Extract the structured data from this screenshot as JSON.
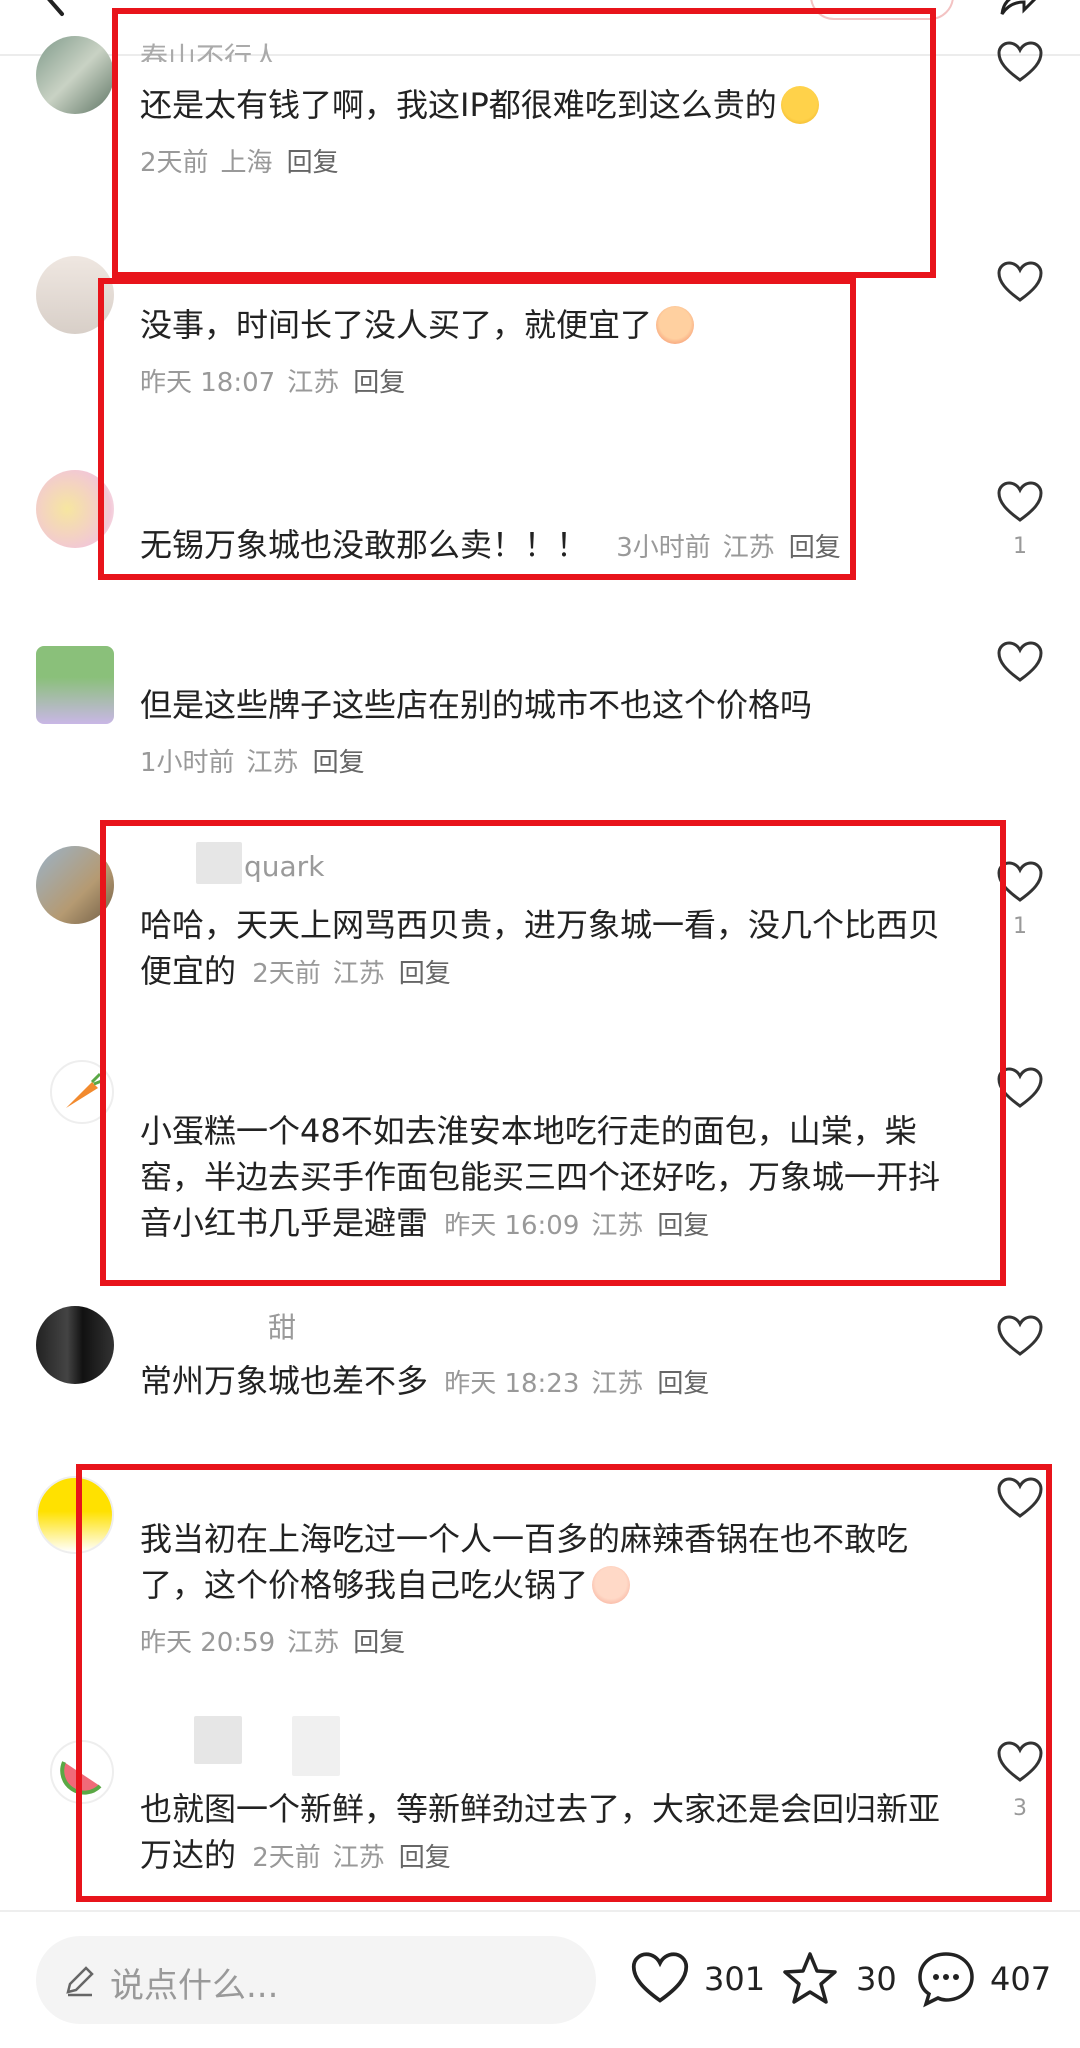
{
  "colors": {
    "highlight": "#e8141b",
    "meta": "#999999",
    "text": "#222222"
  },
  "comments": [
    {
      "username": "春山不行人",
      "text": "还是太有钱了啊，我这IP都很难吃到这么贵的",
      "emoji": "laughing-emoji",
      "time": "2天前",
      "location": "上海",
      "reply": "回复"
    },
    {
      "username": "",
      "text": "没事，时间长了没人买了，就便宜了",
      "emoji": "crying-emoji",
      "time": "昨天 18:07",
      "location": "江苏",
      "reply": "回复"
    },
    {
      "username": "",
      "text": "无锡万象城也没敢那么卖！！！",
      "time": "3小时前",
      "location": "江苏",
      "reply": "回复",
      "likes": "1"
    },
    {
      "username": "",
      "text": "但是这些牌子这些店在别的城市不也这个价格吗",
      "time": "1小时前",
      "location": "江苏",
      "reply": "回复"
    },
    {
      "username": "quark",
      "text": "哈哈，天天上网骂西贝贵，进万象城一看，没几个比西贝便宜的",
      "time": "2天前",
      "location": "江苏",
      "reply": "回复",
      "likes": "1"
    },
    {
      "username": "",
      "text": "小蛋糕一个48不如去淮安本地吃行走的面包，山棠，柴窑，半边去买手作面包能买三四个还好吃，万象城一开抖音小红书几乎是避雷",
      "time": "昨天 16:09",
      "location": "江苏",
      "reply": "回复"
    },
    {
      "username": "甜",
      "text": "常州万象城也差不多",
      "time": "昨天 18:23",
      "location": "江苏",
      "reply": "回复"
    },
    {
      "username": "",
      "text": "我当初在上海吃过一个人一百多的麻辣香锅在也不敢吃了，这个价格够我自己吃火锅了",
      "emoji": "blushing-emoji",
      "time": "昨天 20:59",
      "location": "江苏",
      "reply": "回复"
    },
    {
      "username": "",
      "text": "也就图一个新鲜，等新鲜劲过去了，大家还是会回归新亚万达的",
      "time": "2天前",
      "location": "江苏",
      "reply": "回复",
      "likes": "3"
    }
  ],
  "bottom_bar": {
    "input_placeholder": "说点什么...",
    "likes": "301",
    "favorites": "30",
    "comments": "407"
  }
}
